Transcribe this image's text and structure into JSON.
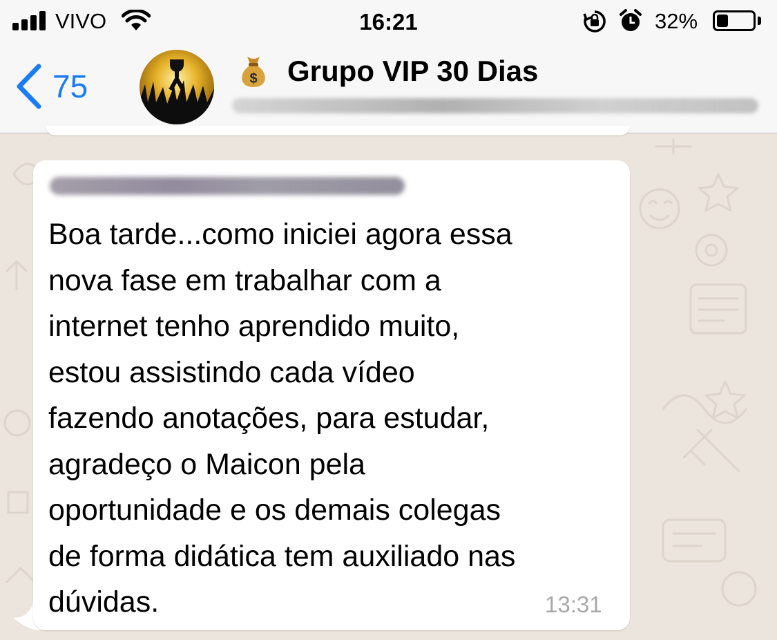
{
  "status_bar": {
    "carrier": "VIVO",
    "time": "16:21",
    "battery_percent": "32%",
    "battery_level": 0.32,
    "icons": [
      "signal-icon",
      "wifi-icon",
      "rotation-lock-icon",
      "alarm-icon",
      "battery-icon"
    ]
  },
  "header": {
    "back_count": "75",
    "group_name": "Grupo VIP 30 Dias",
    "title_emoji": "money-bag-icon",
    "accent_color": "#1a7cf5"
  },
  "message": {
    "text": "Boa tarde...como iniciei agora essa\nnova fase em trabalhar com a\ninternet tenho aprendido muito,\nestou assistindo cada vídeo\nfazendo anotações, para estudar,\nagradeço o Maicon pela\noportunidade e os demais colegas\nde forma didática tem auxiliado nas\ndúvidas.",
    "time": "13:31"
  }
}
